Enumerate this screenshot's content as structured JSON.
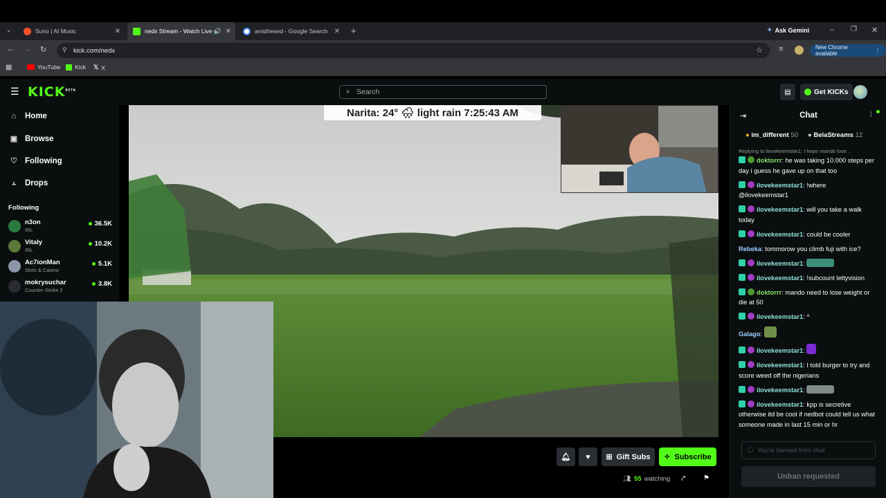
{
  "browser": {
    "tabs": [
      {
        "label": "Suno | AI Music",
        "icon": "suno-favicon",
        "color": "#f0522c"
      },
      {
        "label": "nedx Stream - Watch Live o",
        "icon": "kick-favicon",
        "color": "#53fc18"
      },
      {
        "label": "anisthesed - Google Search",
        "icon": "google-favicon",
        "color": "#4285f4"
      }
    ],
    "ask_gemini": "Ask Gemini",
    "url": "kick.com/nedx",
    "new_chrome": "New Chrome available",
    "bookmarks": [
      "YouTube",
      "Kick",
      "X"
    ]
  },
  "kick": {
    "logo": "KICK",
    "logo_tag": "BETA",
    "search_placeholder": "Search",
    "get_kicks": "Get KICKs",
    "accent": "#53fc18"
  },
  "sidebar": {
    "nav": [
      {
        "label": "Home",
        "icon": "home-icon"
      },
      {
        "label": "Browse",
        "icon": "browse-icon"
      },
      {
        "label": "Following",
        "icon": "heart-icon"
      },
      {
        "label": "Drops",
        "icon": "drops-icon"
      }
    ],
    "following_heading": "Following",
    "following": [
      {
        "name": "n3on",
        "category": "IRL",
        "viewers": "36.5K"
      },
      {
        "name": "Vitaly",
        "category": "IRL",
        "viewers": "10.2K"
      },
      {
        "name": "Ac7ionMan",
        "category": "Slots & Casino",
        "viewers": "5.1K"
      },
      {
        "name": "mokrysuchar",
        "category": "Counter-Strike 2",
        "viewers": "3.8K"
      }
    ]
  },
  "stream": {
    "weather_overlay": "Narita: 24° 🌧 light rain 7:25:43 AM",
    "gift_subs": "Gift Subs",
    "subscribe": "Subscribe",
    "watching_count": "55",
    "watching_label": "watching"
  },
  "chat": {
    "title": "Chat",
    "pinned": [
      {
        "name": "im_different",
        "count": "50"
      },
      {
        "name": "BelaStreams",
        "count": "12"
      }
    ],
    "reply_context": "Replying to ilovekeemstar1: I hope mando lose...",
    "messages": [
      {
        "user": "doktorrr",
        "text": "he was taking 10.000 steps per day i guess he gave up on that too"
      },
      {
        "user": "ilovekeemstar1",
        "text": "!where @ilovekeemstar1"
      },
      {
        "user": "ilovekeemstar1",
        "text": "will you take a walk today"
      },
      {
        "user": "ilovekeemstar1",
        "text": "could be cooler"
      },
      {
        "user": "Rebeka",
        "text": "tommorow you climb fuji with ice?"
      },
      {
        "user": "ilovekeemstar1",
        "text": ""
      },
      {
        "user": "ilovekeemstar1",
        "text": "!subcount lettyvision"
      },
      {
        "user": "doktorrr",
        "text": "mando need to lose weight or die at 50"
      },
      {
        "user": "ilovekeemstar1",
        "text": "^"
      },
      {
        "user": "Galago",
        "text": ""
      },
      {
        "user": "ilovekeemstar1",
        "text": ""
      },
      {
        "user": "ilovekeemstar1",
        "text": "I told burger to try and score weed off the nigerians"
      },
      {
        "user": "ilovekeemstar1",
        "text": ""
      },
      {
        "user": "ilovekeemstar1",
        "text": "kpp is secretive otherwise itd be cool if nedbot could tell us what someone made in last 15 min or hr"
      }
    ],
    "input_placeholder": "You're banned from chat",
    "unban_button": "Unban requested"
  }
}
